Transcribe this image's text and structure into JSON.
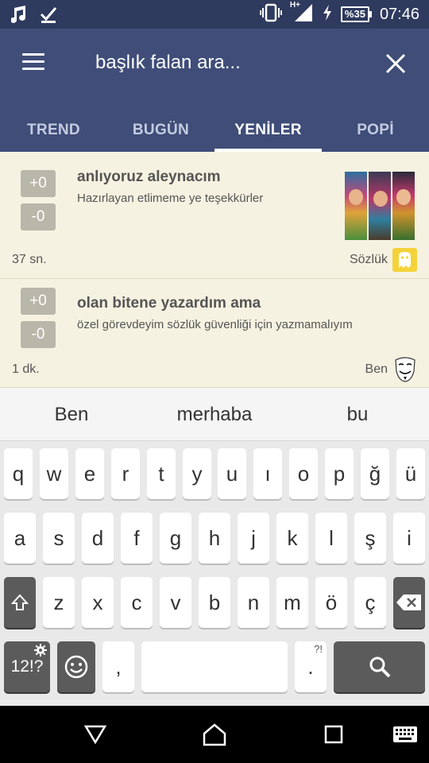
{
  "status_bar": {
    "time": "07:46",
    "battery": "%35",
    "network": "H+",
    "icons": [
      "music-note-icon",
      "checkmark-icon",
      "vibrate-icon",
      "signal-icon",
      "charging-icon",
      "battery-icon"
    ]
  },
  "app_bar": {
    "search_placeholder": "başlık falan ara...",
    "tabs": [
      {
        "label": "TREND",
        "active": false
      },
      {
        "label": "BUGÜN",
        "active": false
      },
      {
        "label": "YENİLER",
        "active": true
      },
      {
        "label": "POPİ",
        "active": false
      }
    ]
  },
  "entries": [
    {
      "upvote": "+0",
      "downvote": "-0",
      "title": "anlıyoruz aleynacım",
      "subtitle": "Hazırlayan etlimeme ye teşekkürler",
      "time": "37 sn.",
      "source": "Sözlük",
      "source_icon": "inci-badge-icon",
      "has_thumbnail": true
    },
    {
      "upvote": "+0",
      "downvote": "-0",
      "title": "olan bitene yazardım ama",
      "subtitle": "özel görevdeyim sözlük güvenliği için yazmamalıyım",
      "time": "1 dk.",
      "source": "Ben",
      "source_icon": "guy-fawkes-mask-icon",
      "has_thumbnail": false
    }
  ],
  "suggestions": [
    "Ben",
    "merhaba",
    "bu"
  ],
  "keyboard": {
    "row1": [
      "q",
      "w",
      "e",
      "r",
      "t",
      "y",
      "u",
      "ı",
      "o",
      "p",
      "ğ",
      "ü"
    ],
    "row2": [
      "a",
      "s",
      "d",
      "f",
      "g",
      "h",
      "j",
      "k",
      "l",
      "ş",
      "i"
    ],
    "row3": [
      "z",
      "x",
      "c",
      "v",
      "b",
      "n",
      "m",
      "ö",
      "ç"
    ],
    "symbols_key": "12!?",
    "comma_key": ",",
    "period_key": ".",
    "period_hint": "?!"
  },
  "colors": {
    "status_bar": "#2e3a5e",
    "app_bar": "#3f4d78",
    "feed_bg": "#f5f2e1",
    "vote_button": "#b9b7a9",
    "inci_badge": "#f4d33a"
  }
}
